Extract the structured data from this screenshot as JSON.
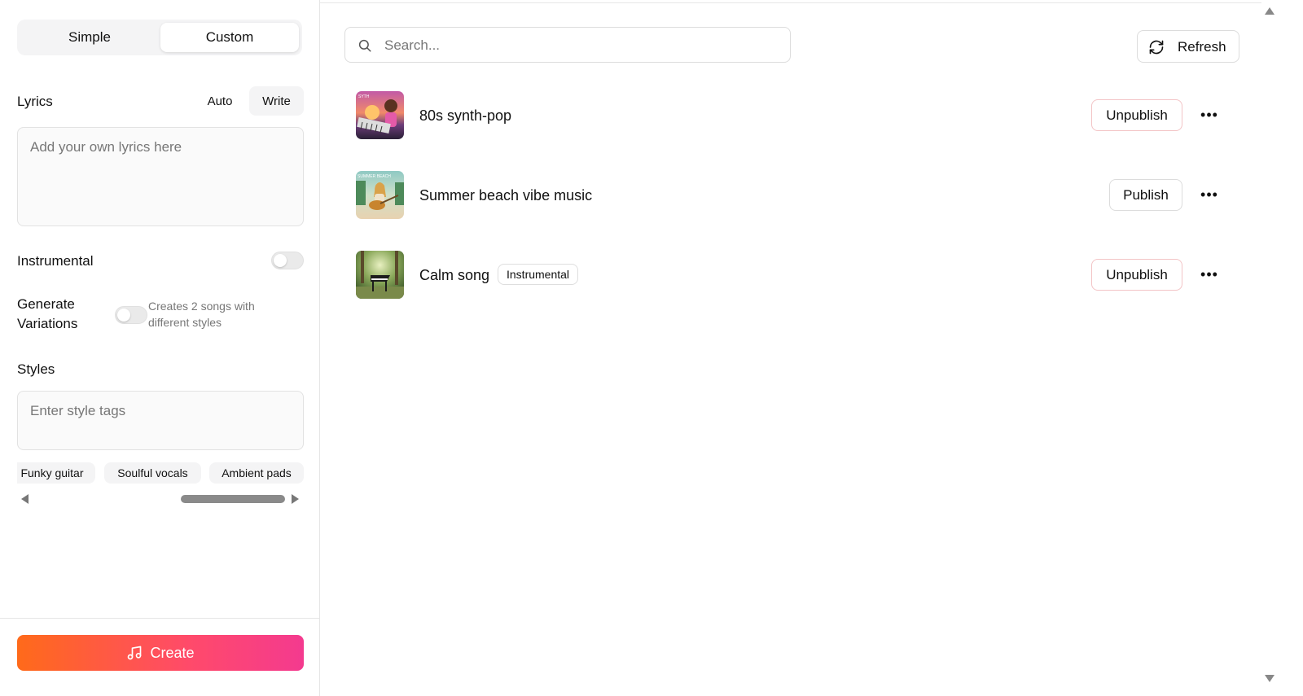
{
  "left_panel": {
    "mode_tabs": {
      "simple": "Simple",
      "custom": "Custom",
      "active": "Custom"
    },
    "lyrics": {
      "label": "Lyrics",
      "mode_auto": "Auto",
      "mode_write": "Write",
      "active_mode": "Write",
      "placeholder": "Add your own lyrics here",
      "value": ""
    },
    "instrumental": {
      "label": "Instrumental",
      "enabled": false
    },
    "generate_variations": {
      "label": "Generate Variations",
      "description": "Creates 2 songs with different styles",
      "enabled": false
    },
    "styles": {
      "label": "Styles",
      "placeholder": "Enter style tags",
      "value": "",
      "suggestions": [
        "Funky guitar",
        "Soulful vocals",
        "Ambient pads"
      ]
    },
    "create_button": {
      "label": "Create",
      "icon": "music-note-icon"
    }
  },
  "main": {
    "search": {
      "placeholder": "Search...",
      "value": "",
      "icon": "search-icon"
    },
    "refresh_button": {
      "label": "Refresh",
      "icon": "refresh-icon"
    },
    "songs": [
      {
        "title": "80s synth-pop",
        "tag": "",
        "action": "Unpublish",
        "more": "•••",
        "thumb_text": "SYTH"
      },
      {
        "title": "Summer beach vibe music",
        "tag": "",
        "action": "Publish",
        "more": "•••",
        "thumb_text": "SUMMER BEACH"
      },
      {
        "title": "Calm song",
        "tag": "Instrumental",
        "action": "Unpublish",
        "more": "•••",
        "thumb_text": ""
      }
    ]
  },
  "colors": {
    "create_gradient_start": "#ff6a1a",
    "create_gradient_end": "#f43a8f",
    "unpublish_border": "#f3c4c6",
    "panel_border": "#e5e5e5"
  }
}
